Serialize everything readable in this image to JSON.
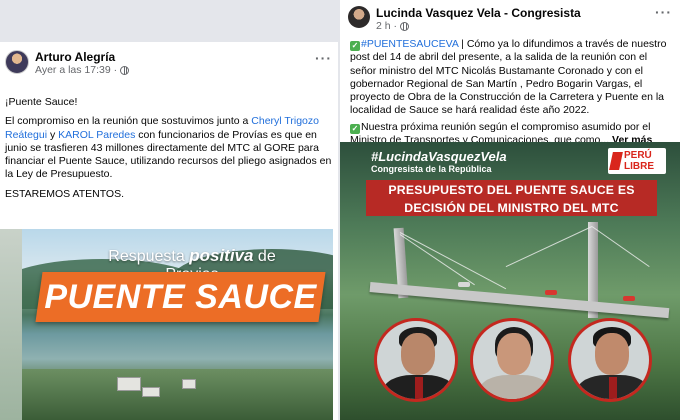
{
  "left_post": {
    "author": "Arturo Alegría",
    "meta": "Ayer a las 17:39 ·",
    "more_icon": "more-dots-icon",
    "line1": "¡Puente Sauce!",
    "text_a": "El compromiso en la reunión que sostuvimos junto a ",
    "mention1": "Cheryl Trigozo Reátegui",
    "text_b": " y ",
    "mention2": "KAROL Paredes",
    "text_c": " con funcionarios de Provías es que en junio se trasfieren 43 millones directamente del MTC al GORE para financiar el Puente Sauce, utilizando recursos del pliego asignados en la Ley de Presupuesto.",
    "closing": "ESTAREMOS ATENTOS.",
    "image": {
      "banner_pre": "Respuesta ",
      "banner_bold": "positiva",
      "banner_post": " de Provias",
      "banner_main": "PUENTE SAUCE",
      "brand_color": "#ec6d26"
    }
  },
  "right_post": {
    "author": "Lucinda Vasquez Vela - Congresista",
    "meta": "2 h ·",
    "more_icon": "more-dots-icon",
    "hashtag": "#PUENTESAUCEVA",
    "para1": " | Cómo ya lo difundimos a través de nuestro post del 14 de abril del presente,  a la salida de la reunión con el señor ministro del MTC Nicolás Bustamante Coronado y con el gobernador Regional de San Martín , Pedro Bogarin Vargas, el proyecto de Obra de la Construcción de la Carretera y Puente en la localidad de Sauce se hará realidad éste año 2022.",
    "para2": "Nuestra próxima reunión según el compromiso asumido por el Ministro de Transportes y Comunicaciones, que como...",
    "see_more": " Ver más",
    "image": {
      "tag_line": "#LucindaVasquezVela",
      "tag_sub": "Congresista de la República",
      "logo_line1": "PERÚ",
      "logo_line2": "LIBRE",
      "headline1": "PRESUPUESTO DEL PUENTE SAUCE  ES",
      "headline2": "DECISIÓN DEL MINISTRO DEL MTC",
      "accent_color": "#b72a25"
    }
  }
}
